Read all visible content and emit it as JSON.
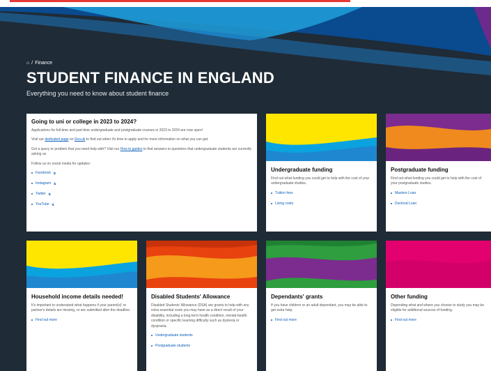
{
  "breadcrumb": {
    "home_icon": "home-icon",
    "current": "Finance"
  },
  "page": {
    "title": "STUDENT FINANCE IN ENGLAND",
    "subtitle": "Everything you need to know about student finance"
  },
  "colors": {
    "accent_link": "#0b5db8",
    "hero_bg": "#1f2b36",
    "hero_blue": "#0a4a8f",
    "hero_cyan": "#1e9ad6",
    "hero_purple": "#6b2a8c"
  },
  "intro_card": {
    "title": "Going to uni or college in 2023 to 2024?",
    "p1": "Applications for full-time and part-time undergraduate and postgraduate courses in 2023 to 2024 are now open!",
    "p2_pre": "Visit our ",
    "p2_link1": "dedicated page",
    "p2_mid": " on ",
    "p2_link2": "Gov.uk",
    "p2_post": " to find out when it's time to apply and for more information on what you can get.",
    "p3_pre": "Got a query or problem that you need help with? Visit our ",
    "p3_link": "How to guides",
    "p3_post": " to find answers to questions that undergraduate students are currently asking us.",
    "p4": "Follow us on social media for updates:",
    "links": [
      "Facebook",
      "Instagram",
      "Twitter",
      "YouTube"
    ]
  },
  "cards": {
    "undergrad": {
      "title": "Undergraduate funding",
      "text": "Find out what funding you could get to help with the cost of your undergraduate studies.",
      "links": [
        "Tuition fees",
        "Living costs"
      ]
    },
    "postgrad": {
      "title": "Postgraduate funding",
      "text": "Find out what funding you could get to help with the cost of your postgraduate studies.",
      "links": [
        "Masters Loan",
        "Doctoral Loan"
      ]
    },
    "household": {
      "title": "Household income details needed!",
      "text": "It's important to understand what happens if your parent(s)' or partner's details are missing, or are submitted after the deadline.",
      "links": [
        "Find out more"
      ]
    },
    "dsa": {
      "title": "Disabled Students' Allowance",
      "text": "Disabled Students' Allowance (DSA) are grants to help with any extra essential costs you may have as a direct result of your disability, including a long-term health condition, mental-health condition or specific learning difficulty such as dyslexia or dyspraxia.",
      "links": [
        "Undergraduate students",
        "Postgraduate students"
      ]
    },
    "dependants": {
      "title": "Dependants' grants",
      "text": "If you have children or an adult dependant, you may be able to get extra help.",
      "links": [
        "Find out more"
      ]
    },
    "other": {
      "title": "Other funding",
      "text": "Depending what and where you choose to study you may be eligible for additional sources of funding.",
      "links": [
        "Find out more"
      ]
    }
  }
}
